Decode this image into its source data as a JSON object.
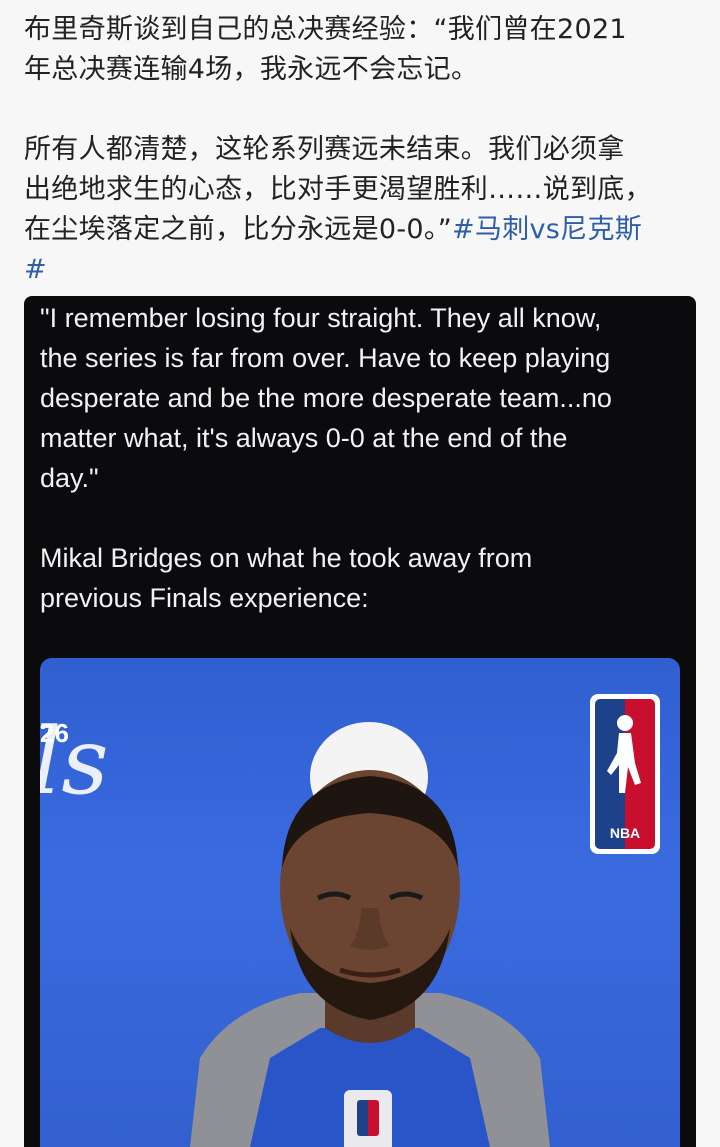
{
  "post": {
    "line1": "布里奇斯谈到自己的总决赛经验：“我们曾在2021",
    "line2": "年总决赛连输4场，我永远不会忘记。",
    "line3": "所有人都清楚，这轮系列赛远未结束。我们必须拿",
    "line4": "出绝地求生的心态，比对手更渴望胜利……说到底，",
    "line5_text": "在尘埃落定之前，比分永远是0-0。”",
    "line5_hashtag": "#马刺vs尼克斯",
    "line6_hashtag": "#"
  },
  "embed": {
    "quote_lines": [
      "\"I remember losing four straight. They all know,",
      "the series is far from over. Have to keep playing",
      "desperate and be the more desperate team...no",
      "matter what, it's always 0-0 at the end of the",
      "day.\""
    ],
    "attribution_lines": [
      "Mikal Bridges on what he took away from",
      "previous Finals experience:"
    ],
    "photo": {
      "backdrop_number": "26",
      "backdrop_letters": "ls",
      "logo_label": "NBA"
    }
  },
  "colors": {
    "background": "#f7f7f7",
    "hashtag": "#2f5ea8",
    "card": "#0b0b0d",
    "photo_blue": "#3a6be0"
  }
}
